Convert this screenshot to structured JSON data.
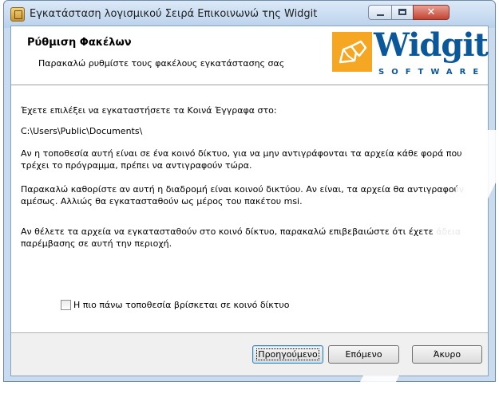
{
  "window": {
    "title": "Εγκατάσταση λογισμικού Σειρά Επικοινωνώ της Widgit",
    "controls": {
      "minimize_icon": "minimize-icon",
      "maximize_icon": "maximize-icon",
      "close_glyph": "✕"
    }
  },
  "header": {
    "title": "Ρύθμιση Φακέλων",
    "subtitle": "Παρακαλώ ρυθμίστε τους φακέλους εγκατάστασης σας",
    "logo": {
      "word": "Widgit",
      "tagline": "SOFTWARE"
    }
  },
  "body": {
    "para1": "Έχετε επιλέξει να εγκαταστήσετε τα Κοινά Έγγραφα στο:",
    "path": "C:\\Users\\Public\\Documents\\",
    "para2": "Αν η τοποθεσία αυτή είναι σε ένα κοινό δίκτυο, για να μην αντιγράφονται τα αρχεία κάθε φορά που τρέχει το πρόγραμμα, πρέπει να αντιγραφούν τώρα.",
    "para3": "Παρακαλώ καθορίστε αν αυτή η διαδρομή είναι κοινού δικτύου. Αν είναι, τα αρχεία θα αντιγραφούν αμέσως. Αλλιώς θα εγκατασταθούν ως μέρος του πακέτου msi.",
    "para4": "Αν θέλετε τα αρχεία να εγκατασταθούν στο κοινό δίκτυο, παρακαλώ επιβεβαιώστε ότι έχετε άδεια παρέμβασης σε αυτή την περιοχή.",
    "checkbox_label": "Η πιο πάνω τοποθεσία βρίσκεται σε κοινό δίκτυο",
    "checkbox_checked": false
  },
  "footer": {
    "back_label": "Προηγούμενο",
    "next_label": "Επόμενο",
    "cancel_label": "Άκυρο"
  },
  "colors": {
    "brand": "#0a5799",
    "accent_logo": "#f5a623"
  }
}
